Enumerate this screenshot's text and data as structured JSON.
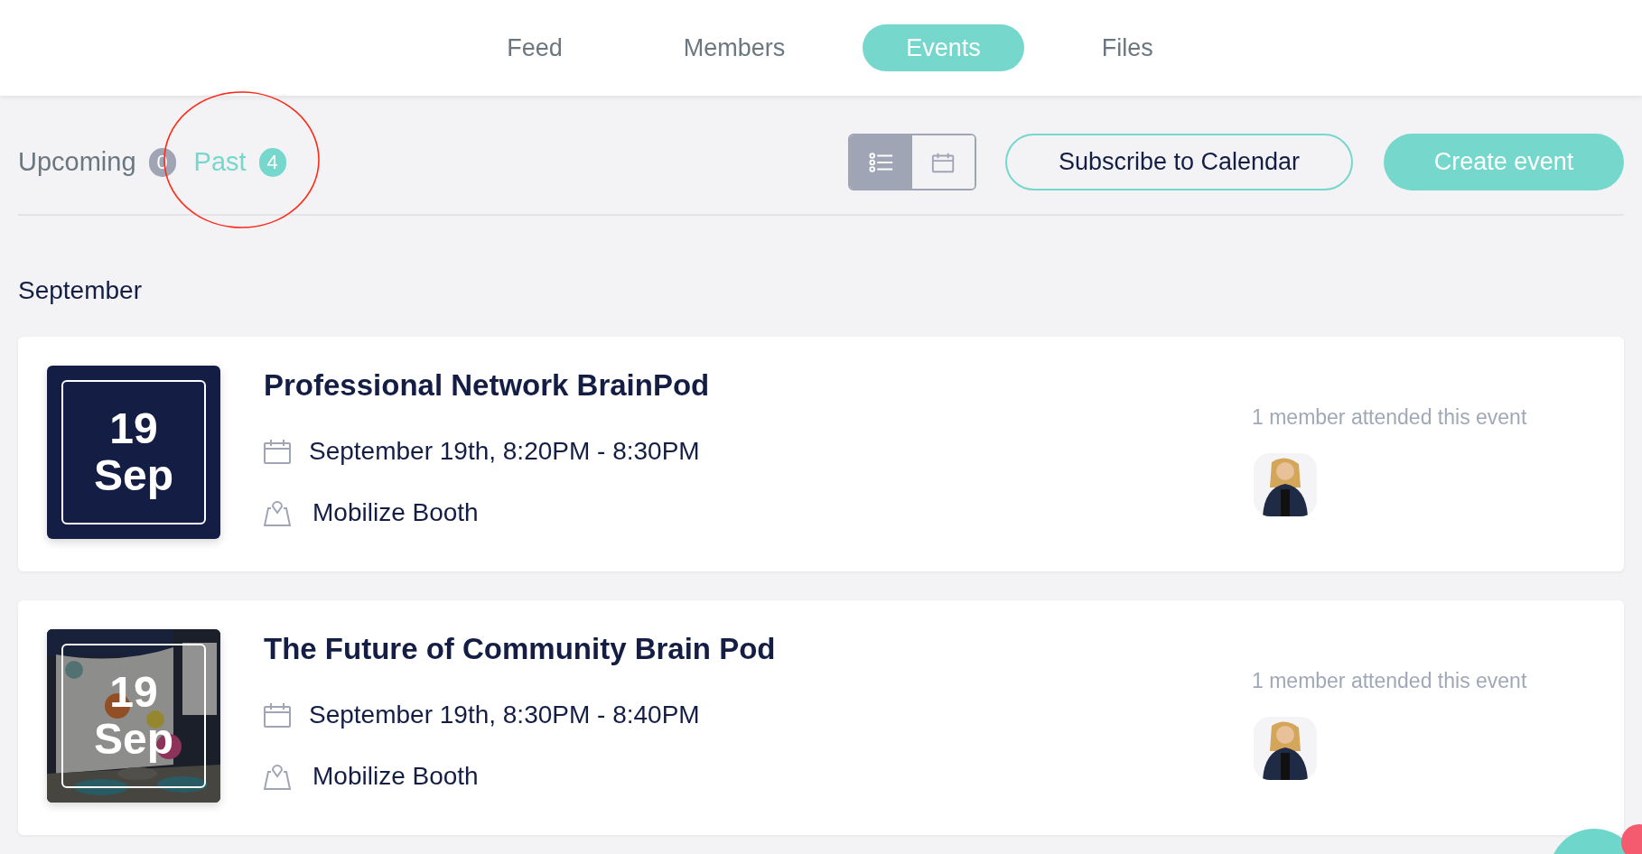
{
  "nav_tabs": [
    {
      "label": "Feed",
      "selected": false
    },
    {
      "label": "Members",
      "selected": false
    },
    {
      "label": "Events",
      "selected": true
    },
    {
      "label": "Files",
      "selected": false
    }
  ],
  "filter_tabs": [
    {
      "label": "Upcoming",
      "count": "0",
      "selected": false
    },
    {
      "label": "Past",
      "count": "4",
      "selected": true
    }
  ],
  "view_toggle": [
    {
      "kind": "list",
      "selected": true
    },
    {
      "kind": "calendar",
      "selected": false
    }
  ],
  "buttons": [
    {
      "label": "Subscribe to Calendar",
      "kind": "outline"
    },
    {
      "label": "Create event",
      "kind": "filled"
    }
  ],
  "month": "September",
  "events": [
    {
      "day": "19",
      "month": "Sep",
      "kind": "plain",
      "title": "Professional Network BrainPod",
      "time": "September 19th, 8:20PM - 8:30PM",
      "location": "Mobilize Booth",
      "attendance": "1 member attended this event"
    },
    {
      "day": "19",
      "month": "Sep",
      "kind": "picture",
      "title": "The Future of Community Brain Pod",
      "time": "September 19th, 8:30PM - 8:40PM",
      "location": "Mobilize Booth",
      "attendance": "1 member attended this event"
    }
  ]
}
